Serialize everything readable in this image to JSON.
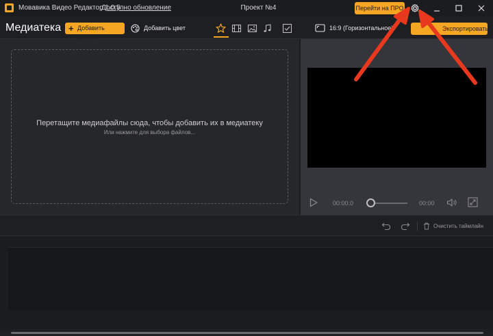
{
  "titlebar": {
    "app_title": "Мовавика Видео Редактор 1.0.5",
    "update_link": "Доступно обновление",
    "project": "Проект №4",
    "pro_button": "Перейти на ПРО"
  },
  "toolbar": {
    "section_title": "Медиатека",
    "add_files": "Добавить файлы",
    "add_color": "Добавить цвет",
    "aspect_ratio": "16:9 (Горизонтальное)",
    "export_button": "Экспортировать п..."
  },
  "media": {
    "drop_main": "Перетащите медиафайлы сюда, чтобы добавить их в медиатеку",
    "drop_sub": "Или нажмите для выбора файлов..."
  },
  "player": {
    "time_current": "00:00.0",
    "time_total": "00:00",
    "progress": 0
  },
  "timeline": {
    "clear_label": "Очистить таймлайн"
  },
  "colors": {
    "accent": "#f5a623",
    "arrow": "#e8391e",
    "background": "#1e1f22",
    "preview_bg": "#35363b"
  },
  "icons": [
    "app-logo-icon",
    "gear-icon",
    "minimize-icon",
    "maximize-icon",
    "close-icon",
    "plus-icon",
    "palette-icon",
    "star-icon",
    "film-icon",
    "image-icon",
    "music-icon",
    "check-icon",
    "aspect-ratio-icon",
    "play-icon",
    "volume-icon",
    "fullscreen-icon",
    "undo-icon",
    "redo-icon",
    "trash-icon"
  ]
}
